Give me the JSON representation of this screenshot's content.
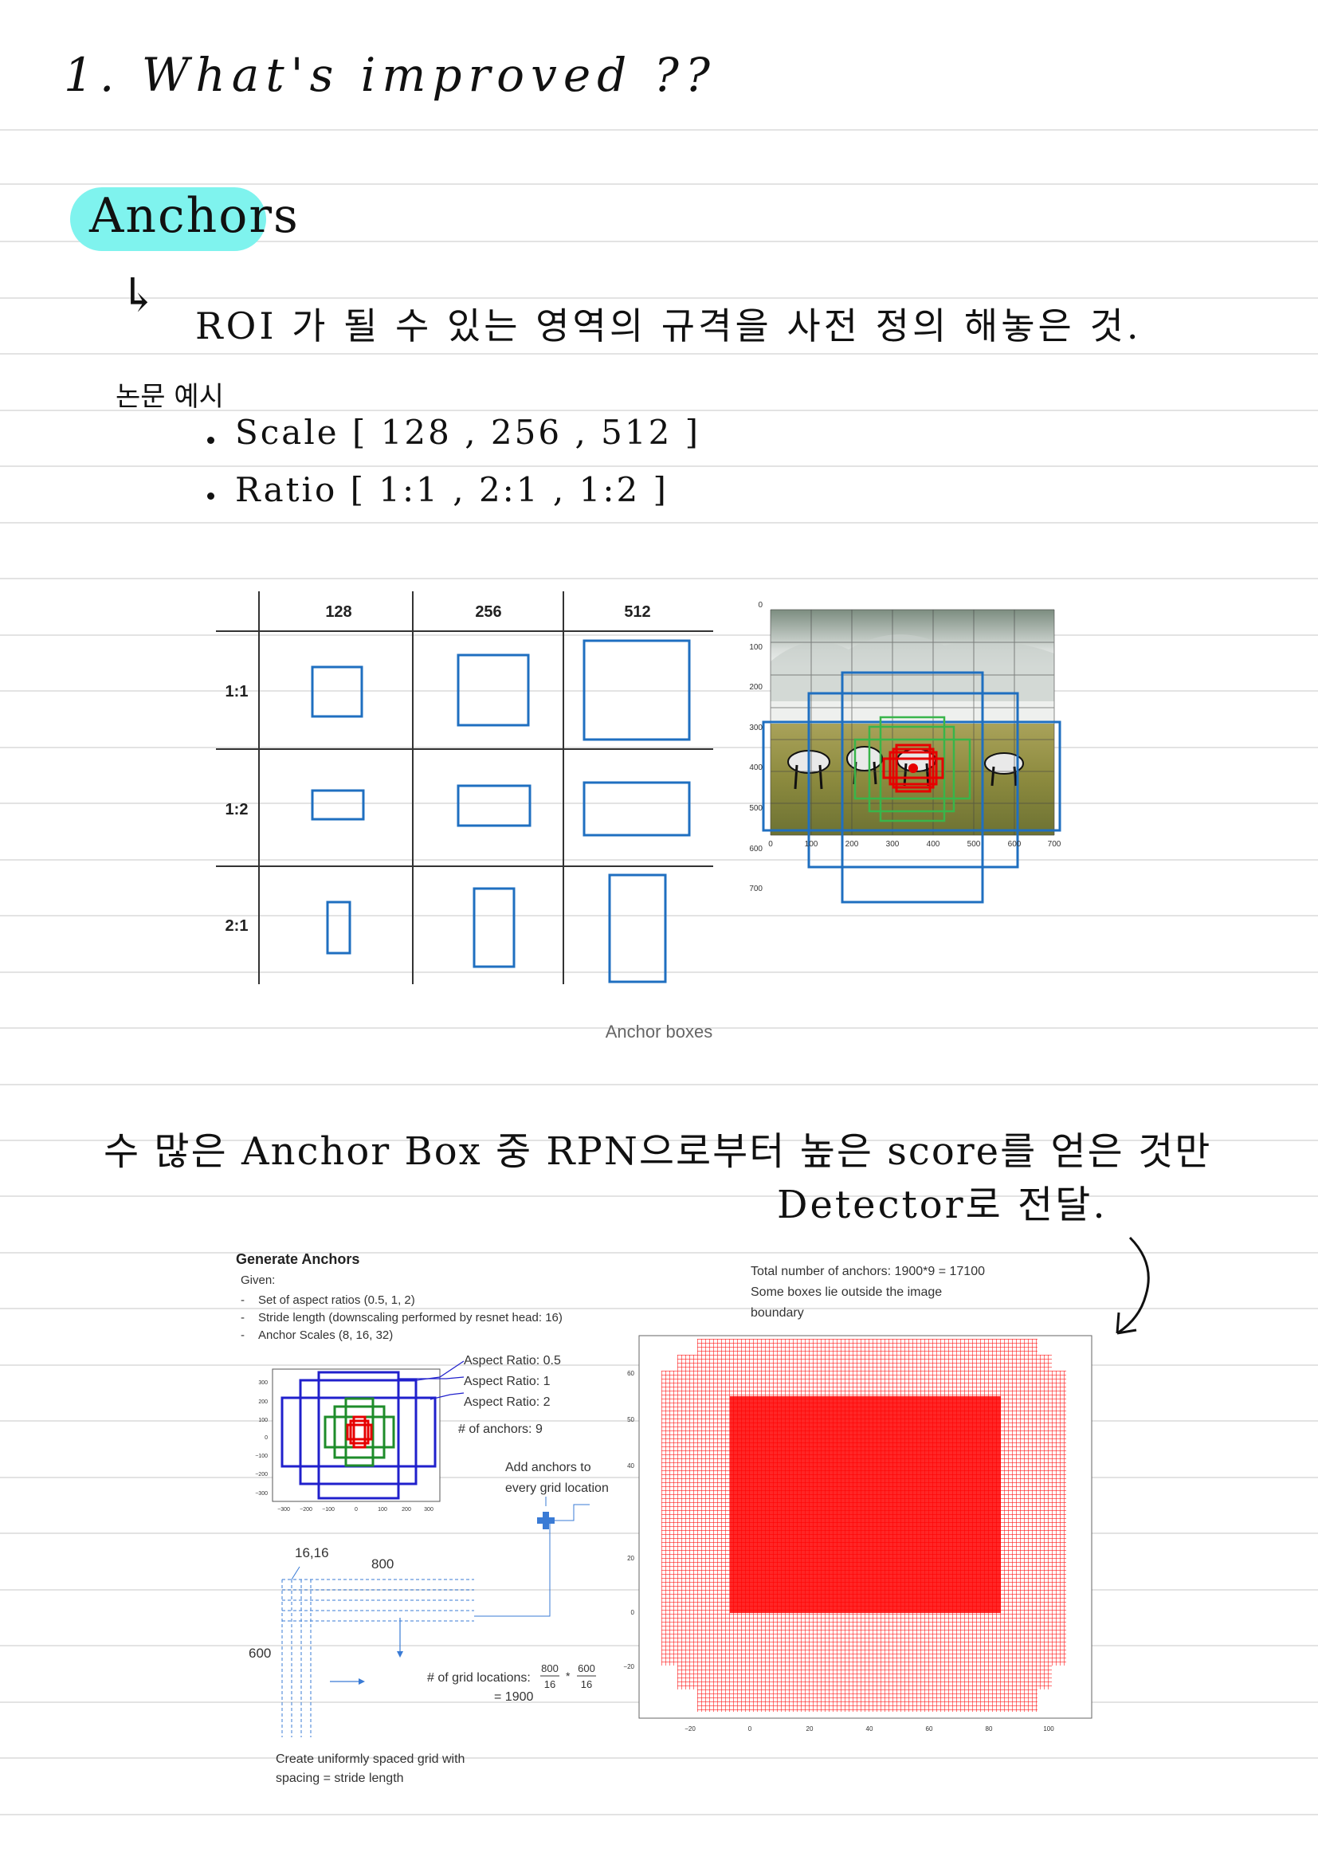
{
  "note": {
    "heading": "1. What's improved ??",
    "section_title": "Anchors",
    "definition_arrow": "↳",
    "definition": "ROI 가 될 수 있는 영역의 규격을 사전 정의 해놓은 것.",
    "example_label": "논문 예시",
    "scale_line": "Scale [ 128 , 256 , 512 ]",
    "ratio_line": "Ratio [ 1:1 , 2:1 , 1:2 ]",
    "rpn_line": "수 많은 Anchor Box 중 RPN으로부터 높은 score를 얻은 것만",
    "detector_line": "Detector로 전달.",
    "side_arrow": "↙"
  },
  "figure1": {
    "caption": "Anchor boxes",
    "table": {
      "column_headers": [
        "128",
        "256",
        "512"
      ],
      "row_headers": [
        "1:1",
        "1:2",
        "2:1"
      ]
    },
    "plot": {
      "x_ticks": [
        "0",
        "100",
        "200",
        "300",
        "400",
        "500",
        "600",
        "700"
      ],
      "y_ticks": [
        "0",
        "100",
        "200",
        "300",
        "400",
        "500",
        "600",
        "700"
      ]
    }
  },
  "figure2": {
    "title": "Generate Anchors",
    "given_label": "Given:",
    "given_items": [
      "Set of aspect ratios (0.5, 1, 2)",
      "Stride length (downscaling performed by resnet head: 16)",
      "Anchor Scales (8, 16, 32)"
    ],
    "legend": [
      "Aspect Ratio: 0.5",
      "Aspect Ratio: 1",
      "Aspect Ratio: 2"
    ],
    "num_anchors": "# of anchors: 9",
    "add_anchors": [
      "Add anchors to",
      "every grid location"
    ],
    "total_anchors": [
      "Total number of anchors: 1900*9 = 17100",
      "Some boxes lie outside the image",
      "boundary"
    ],
    "grid_origin": "16,16",
    "grid_width": "800",
    "grid_height": "600",
    "grid_locations_label": "# of grid locations:",
    "frac1_num": "800",
    "frac1_den": "16",
    "times": "*",
    "frac2_num": "600",
    "frac2_den": "16",
    "grid_locations_result": "= 1900",
    "create_grid": [
      "Create uniformly spaced grid with",
      "spacing = stride length"
    ],
    "small_plot_y_ticks": [
      "300",
      "200",
      "100",
      "0",
      "−100",
      "−200",
      "−300"
    ],
    "small_plot_x_ticks": [
      "−300",
      "−200",
      "−100",
      "0",
      "100",
      "200",
      "300"
    ],
    "big_plot_y_ticks": [
      "60",
      "50",
      "40",
      "20",
      "0",
      "−20"
    ],
    "big_plot_x_ticks": [
      "−20",
      "0",
      "20",
      "40",
      "60",
      "80",
      "100"
    ]
  },
  "colors": {
    "highlight": "#7ff3ee",
    "anchor_blue": "#1f6fc0",
    "anchor_green": "#39b54a",
    "anchor_red": "#e60000"
  }
}
